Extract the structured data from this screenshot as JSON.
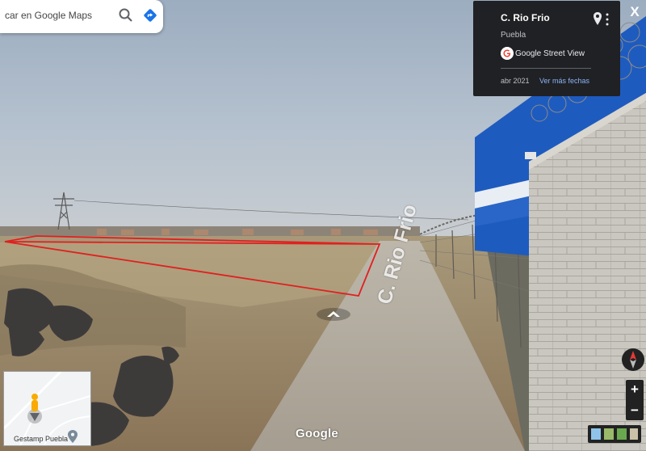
{
  "search": {
    "text": "car en Google Maps"
  },
  "info_card": {
    "title": "C. Rio Frio",
    "subtitle": "Puebla",
    "service": "Google Street View",
    "date": "abr 2021",
    "more_dates_link": "Ver más fechas"
  },
  "minimap": {
    "place": "Gestamp Puebla"
  },
  "road": {
    "label": "C. Rio Frio"
  },
  "footer": {
    "wordmark": "Google"
  },
  "controls": {
    "close": "X",
    "zoom_in": "+",
    "zoom_out": "−"
  },
  "icons": {
    "search": "search-icon",
    "directions": "directions-icon",
    "pin": "location-pin-icon",
    "more": "more-vert-icon",
    "compass": "compass-icon"
  },
  "colors": {
    "marker_outline": "#e02020",
    "card_bg": "#202124",
    "link": "#8ab4f8",
    "directions_blue": "#1a73e8"
  }
}
